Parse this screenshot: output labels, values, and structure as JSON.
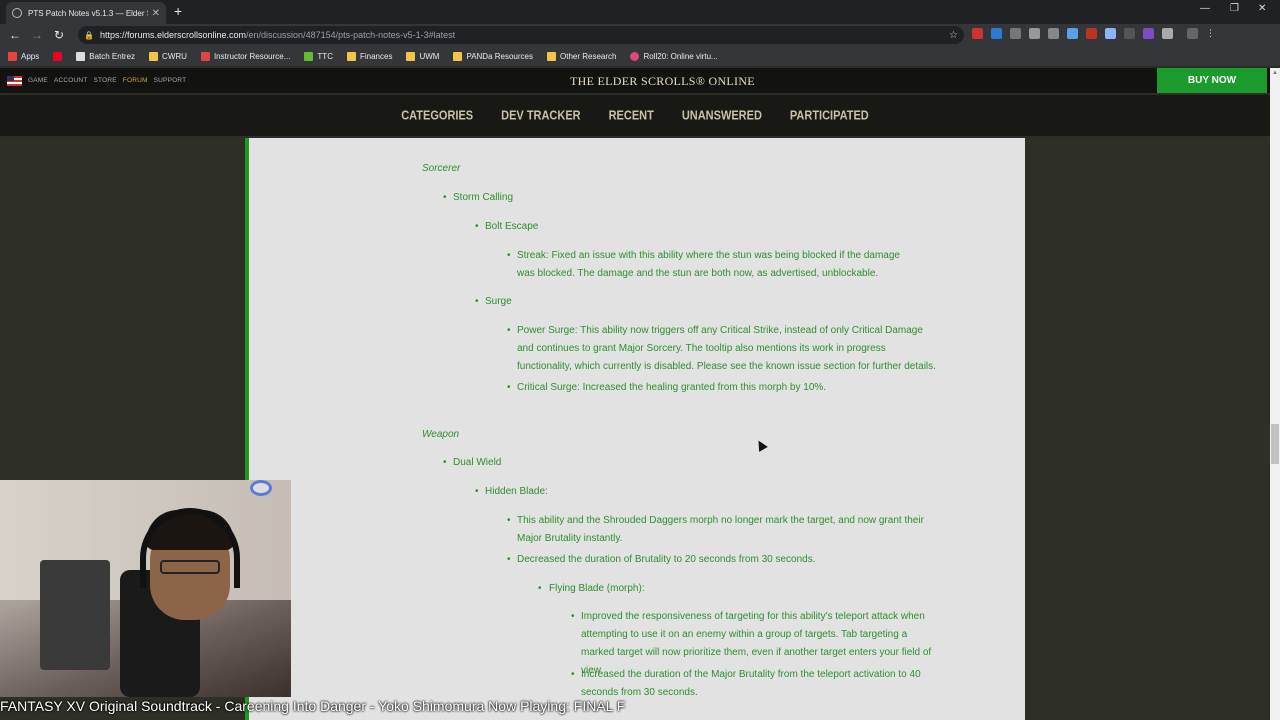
{
  "browser": {
    "tab_title": "PTS Patch Notes v5.1.3 — Elder S",
    "url_host": "https://forums.elderscrollsonline.com",
    "url_path": "/en/discussion/487154/pts-patch-notes-v5-1-3#latest",
    "bookmarks": [
      "Apps",
      "Batch Entrez",
      "CWRU",
      "Instructor Resource...",
      "TTC",
      "Finances",
      "UWM",
      "PANDa Resources",
      "Other Research",
      "Roll20: Online virtu..."
    ]
  },
  "site": {
    "topnav": [
      "GAME",
      "ACCOUNT",
      "STORE",
      "FORUM",
      "SUPPORT"
    ],
    "logo": "THE ELDER SCROLLS® ONLINE",
    "buy_now": "BUY NOW",
    "forumnav": [
      "CATEGORIES",
      "DEV TRACKER",
      "RECENT",
      "UNANSWERED",
      "PARTICIPATED"
    ]
  },
  "post": {
    "sorcerer_header": "Sorcerer",
    "storm_calling": "Storm Calling",
    "bolt_escape": "Bolt Escape",
    "streak": "Streak: Fixed an issue with this ability where the stun was being blocked if the damage was blocked. The damage and the stun are both now, as advertised, unblockable.",
    "surge": "Surge",
    "power_surge": "Power Surge: This ability now triggers off any Critical Strike, instead of only Critical Damage and continues to grant Major Sorcery. The tooltip also mentions its work in progress functionality, which currently is disabled. Please see the known issue section for further details.",
    "critical_surge": "Critical Surge: Increased the healing granted from this morph by 10%.",
    "weapon_header": "Weapon",
    "dual_wield": "Dual Wield",
    "hidden_blade": "Hidden Blade:",
    "hb_note1": "This ability and the Shrouded Daggers morph no longer mark the target, and now grant their Major Brutality instantly.",
    "hb_note2": "Decreased the duration of Brutality to 20 seconds from 30 seconds.",
    "flying_blade": "Flying Blade (morph):",
    "fb_note1": "Improved the responsiveness of targeting for this ability's teleport attack when attempting to use it on an enemy within a group of targets. Tab targeting a marked target will now prioritize them, even if another target enters your field of view.",
    "fb_note2": "Increased the duration of the Major Brutality from the teleport activation to 40 seconds from 30 seconds."
  },
  "overlay": {
    "now_playing": "FANTASY XV Original Soundtrack - Careening Into Danger - Yoko Shimomura Now Playing: FINAL F"
  }
}
